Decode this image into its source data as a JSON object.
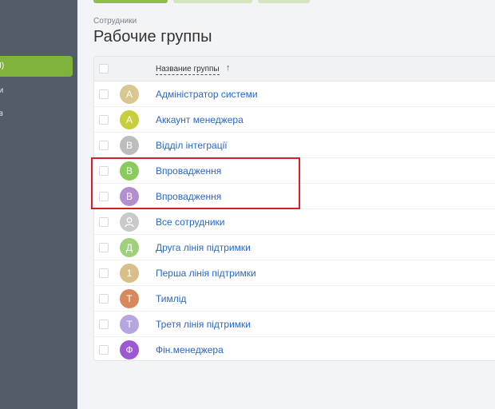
{
  "sidebar": {
    "items": [
      {
        "label": "Ы)",
        "active": true
      },
      {
        "label": "ии"
      },
      {
        "label": "ов"
      }
    ]
  },
  "header": {
    "breadcrumb": "Сотрудники",
    "title": "Рабочие группы"
  },
  "table": {
    "column_name": "Название группы",
    "sort_icon": "arrow-up-icon",
    "rows": [
      {
        "initial": "А",
        "name": "Адміністратор системи",
        "color": "#d8c78e"
      },
      {
        "initial": "А",
        "name": "Аккаунт менеджера",
        "color": "#c8cf3c"
      },
      {
        "initial": "В",
        "name": "Відділ інтеграції",
        "color": "#bdbdbd"
      },
      {
        "initial": "В",
        "name": "Впровадження",
        "color": "#8bcb5d"
      },
      {
        "initial": "В",
        "name": "Впровадження",
        "color": "#b48fcf"
      },
      {
        "initial": "",
        "name": "Все сотрудники",
        "color": "#c9c9c9",
        "icon": "user-group-icon"
      },
      {
        "initial": "Д",
        "name": "Друга лінія підтримки",
        "color": "#9fd17b"
      },
      {
        "initial": "1",
        "name": "Перша лінія підтримки",
        "color": "#d8bf8a"
      },
      {
        "initial": "Т",
        "name": "Тимлід",
        "color": "#d8895c"
      },
      {
        "initial": "Т",
        "name": "Третя лінія підтримки",
        "color": "#b5a6e0"
      },
      {
        "initial": "Ф",
        "name": "Фін.менеджера",
        "color": "#9c59d1"
      }
    ]
  }
}
